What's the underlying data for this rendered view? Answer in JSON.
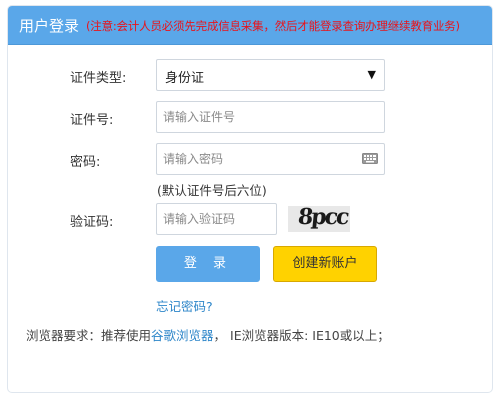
{
  "header": {
    "title": "用户登录",
    "note": "(注意:会计人员必须先完成信息采集，然后才能登录查询办理继续教育业务)"
  },
  "form": {
    "id_type": {
      "label": "证件类型:",
      "selected": "身份证"
    },
    "id_number": {
      "label": "证件号:",
      "placeholder": "请输入证件号"
    },
    "password": {
      "label": "密码:",
      "placeholder": "请输入密码",
      "hint": "(默认证件号后六位)"
    },
    "captcha": {
      "label": "验证码:",
      "placeholder": "请输入验证码",
      "image_text": "8pcc"
    }
  },
  "buttons": {
    "login": "登 录",
    "register": "创建新账户"
  },
  "links": {
    "forgot_password": "忘记密码?"
  },
  "footer": {
    "prefix": "浏览器要求：推荐使用",
    "browser_link": "谷歌浏览器",
    "suffix": "， IE浏览器版本: IE10或以上；"
  },
  "colors": {
    "header_bg": "#5aa7e9",
    "note_red": "#e8141b",
    "login_button": "#5aa7e9",
    "register_button": "#ffd200",
    "link_blue": "#2d86c9"
  }
}
